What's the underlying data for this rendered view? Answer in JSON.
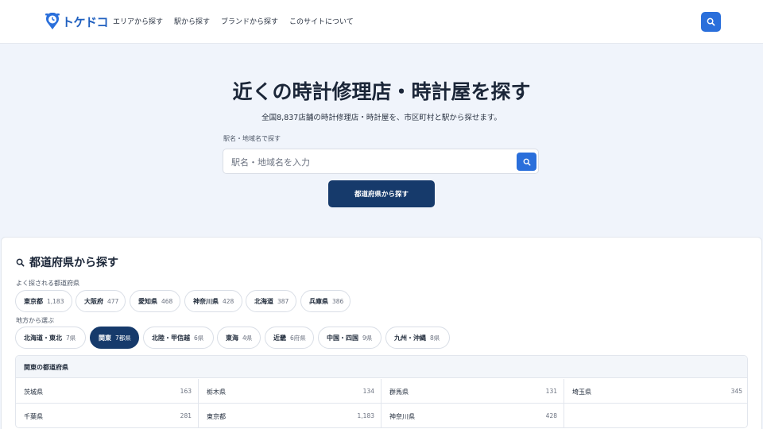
{
  "header": {
    "logo_text": "トケドコ",
    "nav": [
      "エリアから探す",
      "駅から探す",
      "ブランドから探す",
      "このサイトについて"
    ],
    "search_icon": "search-icon"
  },
  "hero": {
    "title": "近くの時計修理店・時計屋を探す",
    "subtitle": "全国8,837店舗の時計修理店・時計屋を、市区町村と駅から探せます。",
    "search_label": "駅名・地域名で探す",
    "search_placeholder": "駅名・地域名を入力",
    "pref_button": "都道府県から探す"
  },
  "prefecture_section": {
    "title": "都道府県から探す",
    "popular_label": "よく探される都道府県",
    "popular": [
      {
        "name": "東京都",
        "count": "1,183"
      },
      {
        "name": "大阪府",
        "count": "477"
      },
      {
        "name": "愛知県",
        "count": "468"
      },
      {
        "name": "神奈川県",
        "count": "428"
      },
      {
        "name": "北海道",
        "count": "387"
      },
      {
        "name": "兵庫県",
        "count": "386"
      }
    ],
    "region_label": "地方から選ぶ",
    "regions": [
      {
        "name": "北海道・東北",
        "count": "7県",
        "active": false
      },
      {
        "name": "関東",
        "count": "7都県",
        "active": true
      },
      {
        "name": "北陸・甲信越",
        "count": "6県",
        "active": false
      },
      {
        "name": "東海",
        "count": "4県",
        "active": false
      },
      {
        "name": "近畿",
        "count": "6府県",
        "active": false
      },
      {
        "name": "中国・四国",
        "count": "9県",
        "active": false
      },
      {
        "name": "九州・沖縄",
        "count": "8県",
        "active": false
      }
    ],
    "panel_title": "関東の都道府県",
    "prefectures": [
      {
        "name": "茨城県",
        "count": "163"
      },
      {
        "name": "栃木県",
        "count": "134"
      },
      {
        "name": "群馬県",
        "count": "131"
      },
      {
        "name": "埼玉県",
        "count": "345"
      },
      {
        "name": "千葉県",
        "count": "281"
      },
      {
        "name": "東京都",
        "count": "1,183"
      },
      {
        "name": "神奈川県",
        "count": "428"
      }
    ]
  },
  "colors": {
    "accent": "#2a6fdb",
    "navy": "#163a6b",
    "background": "#f0f4fb"
  }
}
